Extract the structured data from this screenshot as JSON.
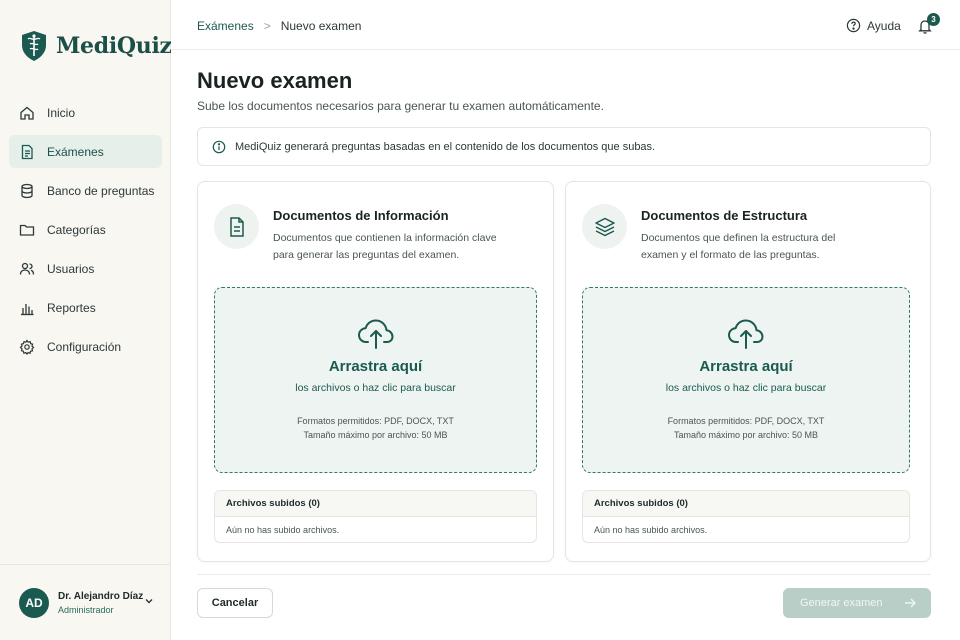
{
  "app": {
    "name": "MediQuiz",
    "brand_color": "#1b5a50"
  },
  "sidebar": {
    "items": [
      {
        "label": "Inicio",
        "icon": "home-icon",
        "active": false
      },
      {
        "label": "Exámenes",
        "icon": "document-icon",
        "active": true
      },
      {
        "label": "Banco de preguntas",
        "icon": "database-icon",
        "active": false
      },
      {
        "label": "Categorías",
        "icon": "folder-icon",
        "active": false
      },
      {
        "label": "Usuarios",
        "icon": "users-icon",
        "active": false
      },
      {
        "label": "Reportes",
        "icon": "bar-chart-icon",
        "active": false
      },
      {
        "label": "Configuración",
        "icon": "gear-icon",
        "active": false
      }
    ],
    "user": {
      "initials": "AD",
      "name": "Dr. Alejandro Díaz",
      "role": "Administrador"
    }
  },
  "header": {
    "breadcrumb": {
      "parent": "Exámenes",
      "separator": ">",
      "current": "Nuevo examen"
    },
    "help_label": "Ayuda",
    "notification_count": "3"
  },
  "main": {
    "title": "Nuevo examen",
    "subtitle": "Sube los documentos necesarios para generar tu examen automáticamente.",
    "info": "MediQuiz generará preguntas basadas en el contenido de los documentos que subas.",
    "cards": [
      {
        "title": "Documentos de Información",
        "description": "Documentos que contienen la información clave para generar las preguntas del examen.",
        "icon": "file-text-icon",
        "drop_title": "Arrastra aquí",
        "drop_sub": "los archivos o haz clic para buscar",
        "formats": "Formatos permitidos: PDF, DOCX, TXT",
        "max_size": "Tamaño máximo por archivo: 50 MB",
        "files_header": "Archivos subidos (0)",
        "files_empty": "Aún no has subido archivos."
      },
      {
        "title": "Documentos de Estructura",
        "description": "Documentos que definen la estructura del examen y el formato de las preguntas.",
        "icon": "layers-icon",
        "drop_title": "Arrastra aquí",
        "drop_sub": "los archivos o haz clic para buscar",
        "formats": "Formatos permitidos: PDF, DOCX, TXT",
        "max_size": "Tamaño máximo por archivo: 50 MB",
        "files_header": "Archivos subidos (0)",
        "files_empty": "Aún no has subido archivos."
      }
    ]
  },
  "footer": {
    "cancel_label": "Cancelar",
    "generate_label": "Generar examen"
  }
}
